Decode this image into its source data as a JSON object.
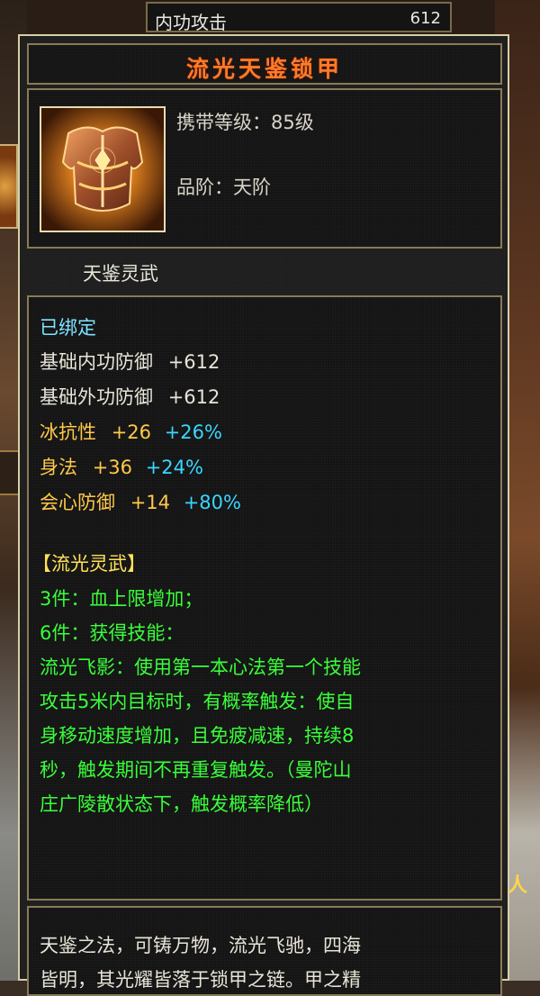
{
  "top_stat": {
    "label": "内功攻击",
    "value": "612"
  },
  "item": {
    "name": "流光天鉴锁甲",
    "carry_level": "携带等级：85级",
    "grade": "品阶：天阶",
    "set_group": "天鉴灵武"
  },
  "status": "已绑定",
  "base_attrs": [
    {
      "name": "基础内功防御",
      "value": "+612"
    },
    {
      "name": "基础外功防御",
      "value": "+612"
    }
  ],
  "bonus_attrs": [
    {
      "name": "冰抗性",
      "value": "+26",
      "pct": "+26%"
    },
    {
      "name": "身法",
      "value": "+36",
      "pct": "+24%"
    },
    {
      "name": "会心防御",
      "value": "+14",
      "pct": "+80%"
    }
  ],
  "set": {
    "title": "【流光灵武】",
    "lines": [
      "3件：血上限增加；",
      "6件：获得技能：",
      "流光飞影：使用第一本心法第一个技能",
      "攻击5米内目标时，有概率触发：使自",
      "身移动速度增加，且免疲减速，持续8",
      "秒，触发期间不再重复触发。（曼陀山",
      "庄广陵散状态下，触发概率降低）"
    ]
  },
  "description": [
    "天鉴之法，可铸万物，流光飞驰，四海",
    "皆明，其光耀皆落于锁甲之链。甲之精"
  ],
  "background_sign": "人"
}
